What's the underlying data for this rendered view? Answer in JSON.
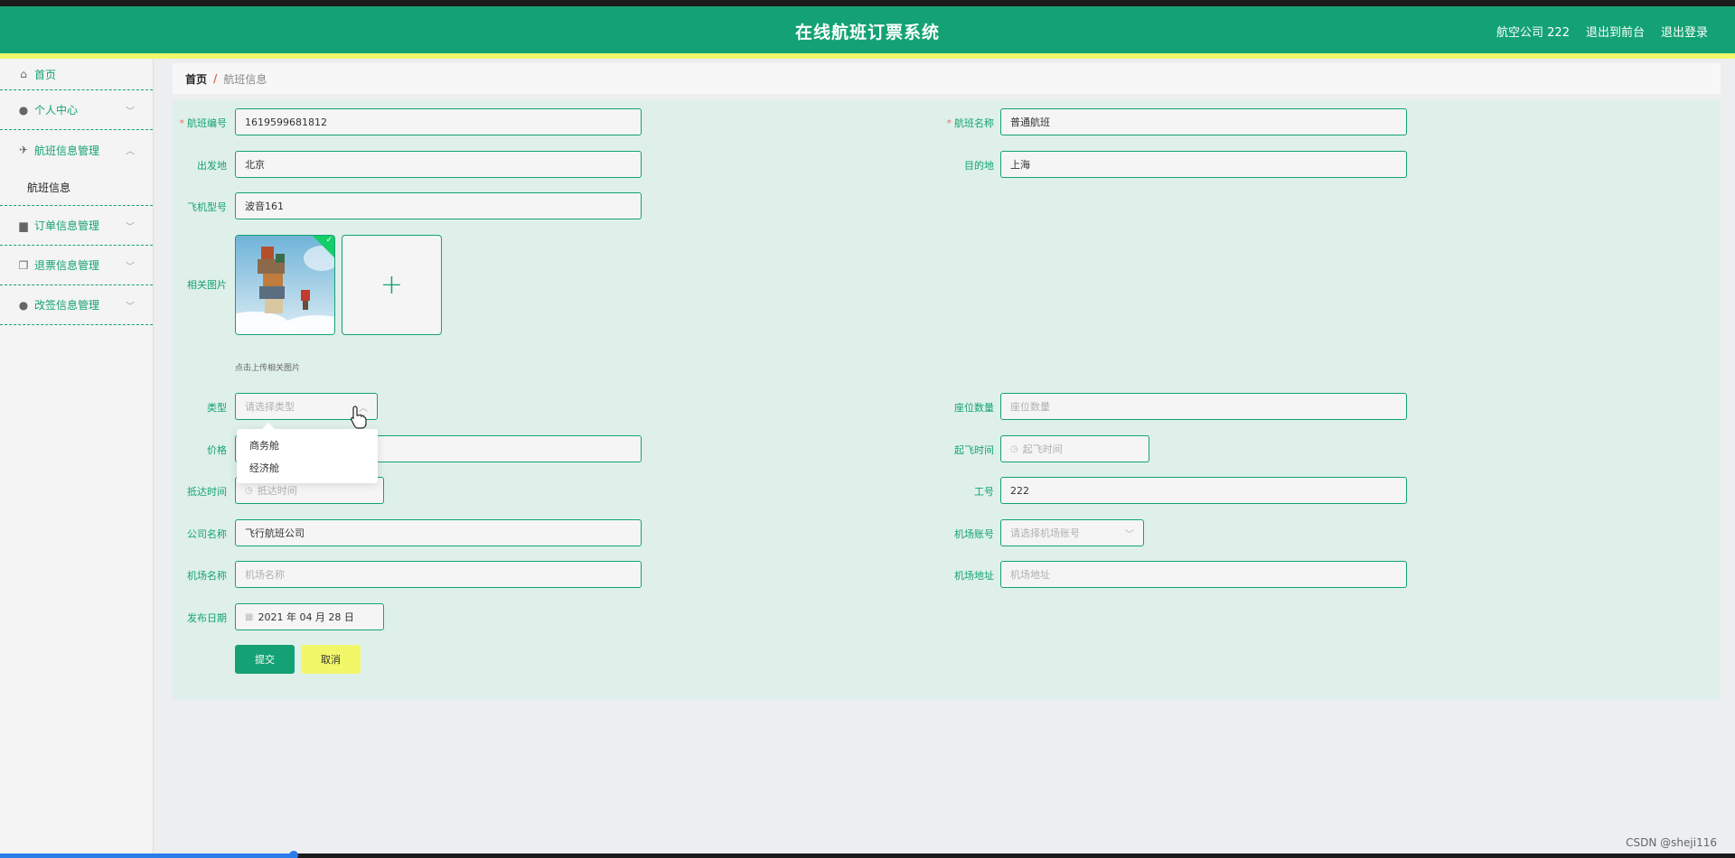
{
  "header": {
    "title": "在线航班订票系统",
    "user": "航空公司 222",
    "front_link": "退出到前台",
    "logout": "退出登录"
  },
  "sidebar": {
    "items": [
      {
        "label": "首页",
        "icon": "home-icon"
      },
      {
        "label": "个人中心",
        "icon": "user-icon"
      },
      {
        "label": "航班信息管理",
        "icon": "plane-icon",
        "expanded": true,
        "sub": [
          "航班信息"
        ]
      },
      {
        "label": "订单信息管理",
        "icon": "briefcase-icon"
      },
      {
        "label": "退票信息管理",
        "icon": "copy-icon"
      },
      {
        "label": "改签信息管理",
        "icon": "user-icon"
      }
    ]
  },
  "breadcrumb": {
    "home": "首页",
    "separator": "/",
    "current": "航班信息"
  },
  "form": {
    "flight_no": {
      "label": "航班编号",
      "value": "1619599681812"
    },
    "flight_name": {
      "label": "航班名称",
      "value": "普通航班"
    },
    "origin": {
      "label": "出发地",
      "value": "北京"
    },
    "destination": {
      "label": "目的地",
      "value": "上海"
    },
    "aircraft": {
      "label": "飞机型号",
      "value": "波音161"
    },
    "image": {
      "label": "相关图片",
      "hint": "点击上传相关图片",
      "add_symbol": "+"
    },
    "type": {
      "label": "类型",
      "placeholder": "请选择类型",
      "options": [
        "商务舱",
        "经济舱"
      ]
    },
    "seats": {
      "label": "座位数量",
      "placeholder": "座位数量"
    },
    "price": {
      "label": "价格"
    },
    "depart_time": {
      "label": "起飞时间",
      "placeholder": "起飞时间"
    },
    "arrive_time": {
      "label": "抵达时间",
      "placeholder": "抵达时间"
    },
    "staff_no": {
      "label": "工号",
      "value": "222"
    },
    "company": {
      "label": "公司名称",
      "value": "飞行航班公司"
    },
    "airport_account": {
      "label": "机场账号",
      "placeholder": "请选择机场账号"
    },
    "airport_name": {
      "label": "机场名称",
      "placeholder": "机场名称"
    },
    "airport_address": {
      "label": "机场地址",
      "placeholder": "机场地址"
    },
    "publish_date": {
      "label": "发布日期",
      "value": "2021 年 04 月 28 日"
    },
    "submit": "提交",
    "cancel": "取消"
  },
  "watermark": "CSDN @sheji116",
  "colors": {
    "primary": "#14a274",
    "accent_yellow": "#f2f76a",
    "form_bg": "#dff0ea"
  }
}
